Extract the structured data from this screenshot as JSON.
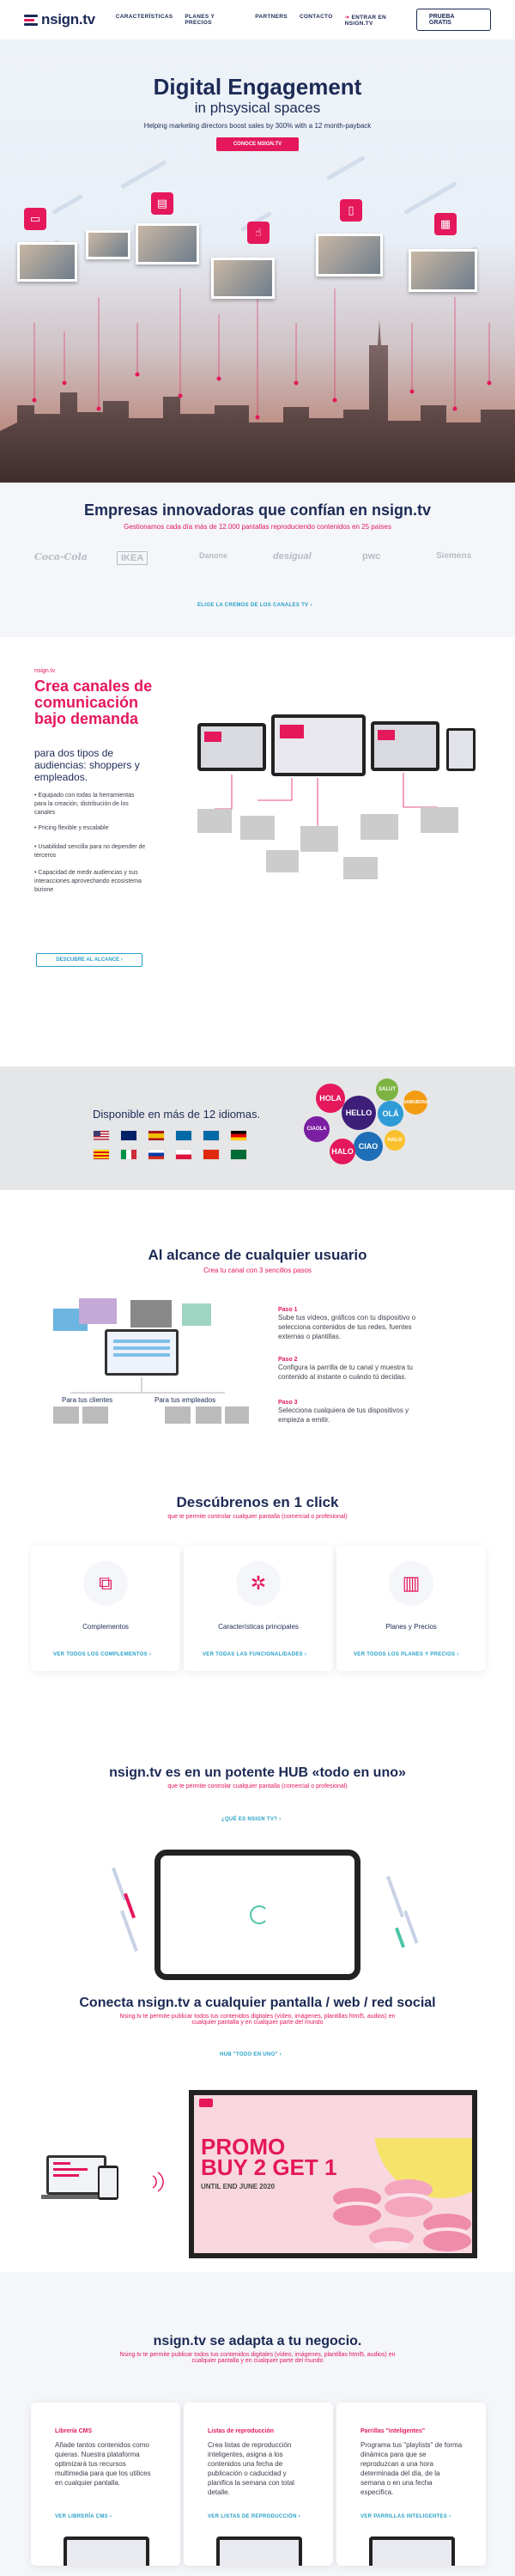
{
  "nav": {
    "logo": "nsign.tv",
    "links": [
      "CARACTERÍSTICAS",
      "PLANES Y PRECIOS",
      "PARTNERS",
      "CONTACTO"
    ],
    "login": "ENTRAR EN NSIGN.TV",
    "trial": "PRUEBA GRATIS"
  },
  "hero": {
    "title": "Digital Engagement",
    "subtitle": "in phsysical spaces",
    "tagline": "Helping marketing directors boost sales by 300% with a 12 month-payback",
    "cta": "CONOCE NSIGN.TV"
  },
  "brands": {
    "title": "Empresas innovadoras que confían en nsign.tv",
    "subtitle": "Gestionamos cada día más de 12.000 pantallas reproduciendo contenidos en 25 países",
    "logos": [
      "Coca-Cola",
      "IKEA",
      "Danone",
      "desigual",
      "pwc",
      "Siemens"
    ],
    "link": "ELIGE LA CREMOS DE LOS CANALES TV"
  },
  "channels": {
    "eyebrow": "nsign.tv",
    "title": "Crea canales de comunicación bajo demanda",
    "lead": "para dos tipos de audiencias: shoppers y empleados.",
    "bullets": [
      "Equipado con todas la herramientas para la creación, distribución de los canales",
      "Pricing flexible y escalable",
      "Usabilidad sencilla para no depender de terceros",
      "Capacidad de medir audiencias y sus interacciones aprovechando ecosistema bizione"
    ],
    "cta": "DESCUBRE AL ALCANCE"
  },
  "languages": {
    "title": "Disponible en más de 12 idiomas.",
    "words": [
      "HOLA",
      "HELLO",
      "OLÁ",
      "SALUT",
      "CIAO",
      "HALO",
      "SAWUBONA",
      "CIAOLA",
      "HALO"
    ]
  },
  "users": {
    "title": "Al alcance de cualquier usuario",
    "subtitle": "Crea tu canal con 3 sencillos pasos",
    "label_clients": "Para tus clientes",
    "label_employees": "Para tus empleados",
    "steps": [
      {
        "t": "Paso 1",
        "d": "Sube tus vídeos, gráficos con tu dispositivo o selecciona contenidos de tus redes, fuentes externas o plantillas."
      },
      {
        "t": "Paso 2",
        "d": "Configura la parrilla de tu canal y muestra tu contenido al instante o cuándo tú decidas."
      },
      {
        "t": "Paso 3",
        "d": "Selecciona cualquiera de tus dispositivos y empieza a emitir."
      }
    ]
  },
  "discover": {
    "title": "Descúbrenos en 1 click",
    "subtitle": "que te permite controlar cualquier pantalla (comercial o profesional)",
    "cards": [
      {
        "name": "Complementos",
        "link": "VER TODOS LOS COMPLEMENTOS"
      },
      {
        "name": "Características principales",
        "link": "VER TODAS LAS FUNCIONALIDADES"
      },
      {
        "name": "Planes y Precios",
        "link": "VER TODOS LOS PLANES Y PRECIOS"
      }
    ]
  },
  "hub": {
    "title": "nsign.tv es en un potente HUB «todo en uno»",
    "subtitle": "que te permite controlar cualquier pantalla (comercial o profesional)",
    "link": "¿QUÉ ES NSIGN TV?"
  },
  "connect": {
    "title": "Conecta nsign.tv a cualquier pantalla / web / red social",
    "subtitle": "Nsing.tv te permite publicar todos tus contenidos digitales (vídeo, imágenes, plantillas html5, audios) en cualquier pantalla y en cualquier parte del mundo",
    "link": "HUB \"TODO EN UNO\"",
    "promo": {
      "l1": "PROMO",
      "l2": "BUY 2 GET 1",
      "l3": "UNTIL END JUNE 2020"
    }
  },
  "adapt": {
    "title": "nsign.tv se adapta a tu negocio.",
    "subtitle": "Nsing.tv te permite publicar todos tus contenidos digitales (vídeo, imágenes, plantillas html5, audios) en cualquier pantalla y en cualquier parte del mundo",
    "cards": [
      {
        "title": "Librería CMS",
        "text": "Añade tantos contenidos como quieras. Nuestra plataforma optimizará tus recursos multimedia para que los utilices en cualquier pantalla.",
        "link": "VER LIBRERÍA CMS"
      },
      {
        "title": "Listas de reproducción",
        "text": "Crea listas de reproducción inteligentes, asigna a los contenidos una fecha de publicación o caducidad y planifica la semana con total detalle.",
        "link": "VER LISTAS DE REPRODUCCIÓN"
      },
      {
        "title": "Parrillas \"inteligentes\"",
        "text": "Programa tus \"playlists\" de forma dinámica para que se reproduzcan a una hora determinada del día, de la semana o en una fecha específica.",
        "link": "VER PARRILLAS INTELIGENTES"
      }
    ]
  },
  "colors": {
    "accent": "#e4185b",
    "navy": "#1c2a55",
    "link": "#27a0c8"
  }
}
